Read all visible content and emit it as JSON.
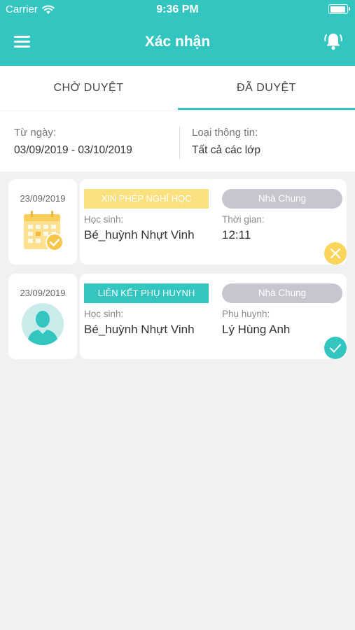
{
  "status_bar": {
    "carrier": "Carrier",
    "time": "9:36 PM"
  },
  "nav": {
    "title": "Xác nhận"
  },
  "tabs": [
    {
      "label": "CHỜ DUYỆT"
    },
    {
      "label": "ĐÃ DUYỆT"
    }
  ],
  "filter": {
    "from_label": "Từ ngày:",
    "from_value": "03/09/2019 - 03/10/2019",
    "type_label": "Loại thông tin:",
    "type_value": "Tất cả các lớp"
  },
  "cards": [
    {
      "date": "23/09/2019",
      "tag": "XIN PHÉP NGHỈ HỌC",
      "group": "Nhà Chung",
      "left_label": "Học sinh:",
      "left_value": "Bé_huỳnh Nhựt Vinh",
      "right_label": "Thời gian:",
      "right_value": "12:11",
      "icon": "calendar-check-icon",
      "status_icon": "close-icon"
    },
    {
      "date": "23/09/2019",
      "tag": "LIÊN KẾT PHỤ HUYNH",
      "group": "Nhà Chung",
      "left_label": "Học sinh:",
      "left_value": "Bé_huỳnh Nhựt Vinh",
      "right_label": "Phụ huynh:",
      "right_value": "Lý Hùng Anh",
      "icon": "user-avatar-icon",
      "status_icon": "check-icon"
    }
  ],
  "colors": {
    "primary": "#33c6c1",
    "warning": "#fbe07f",
    "pill_gray": "#c5c6cf",
    "background": "#f1f1f1"
  }
}
